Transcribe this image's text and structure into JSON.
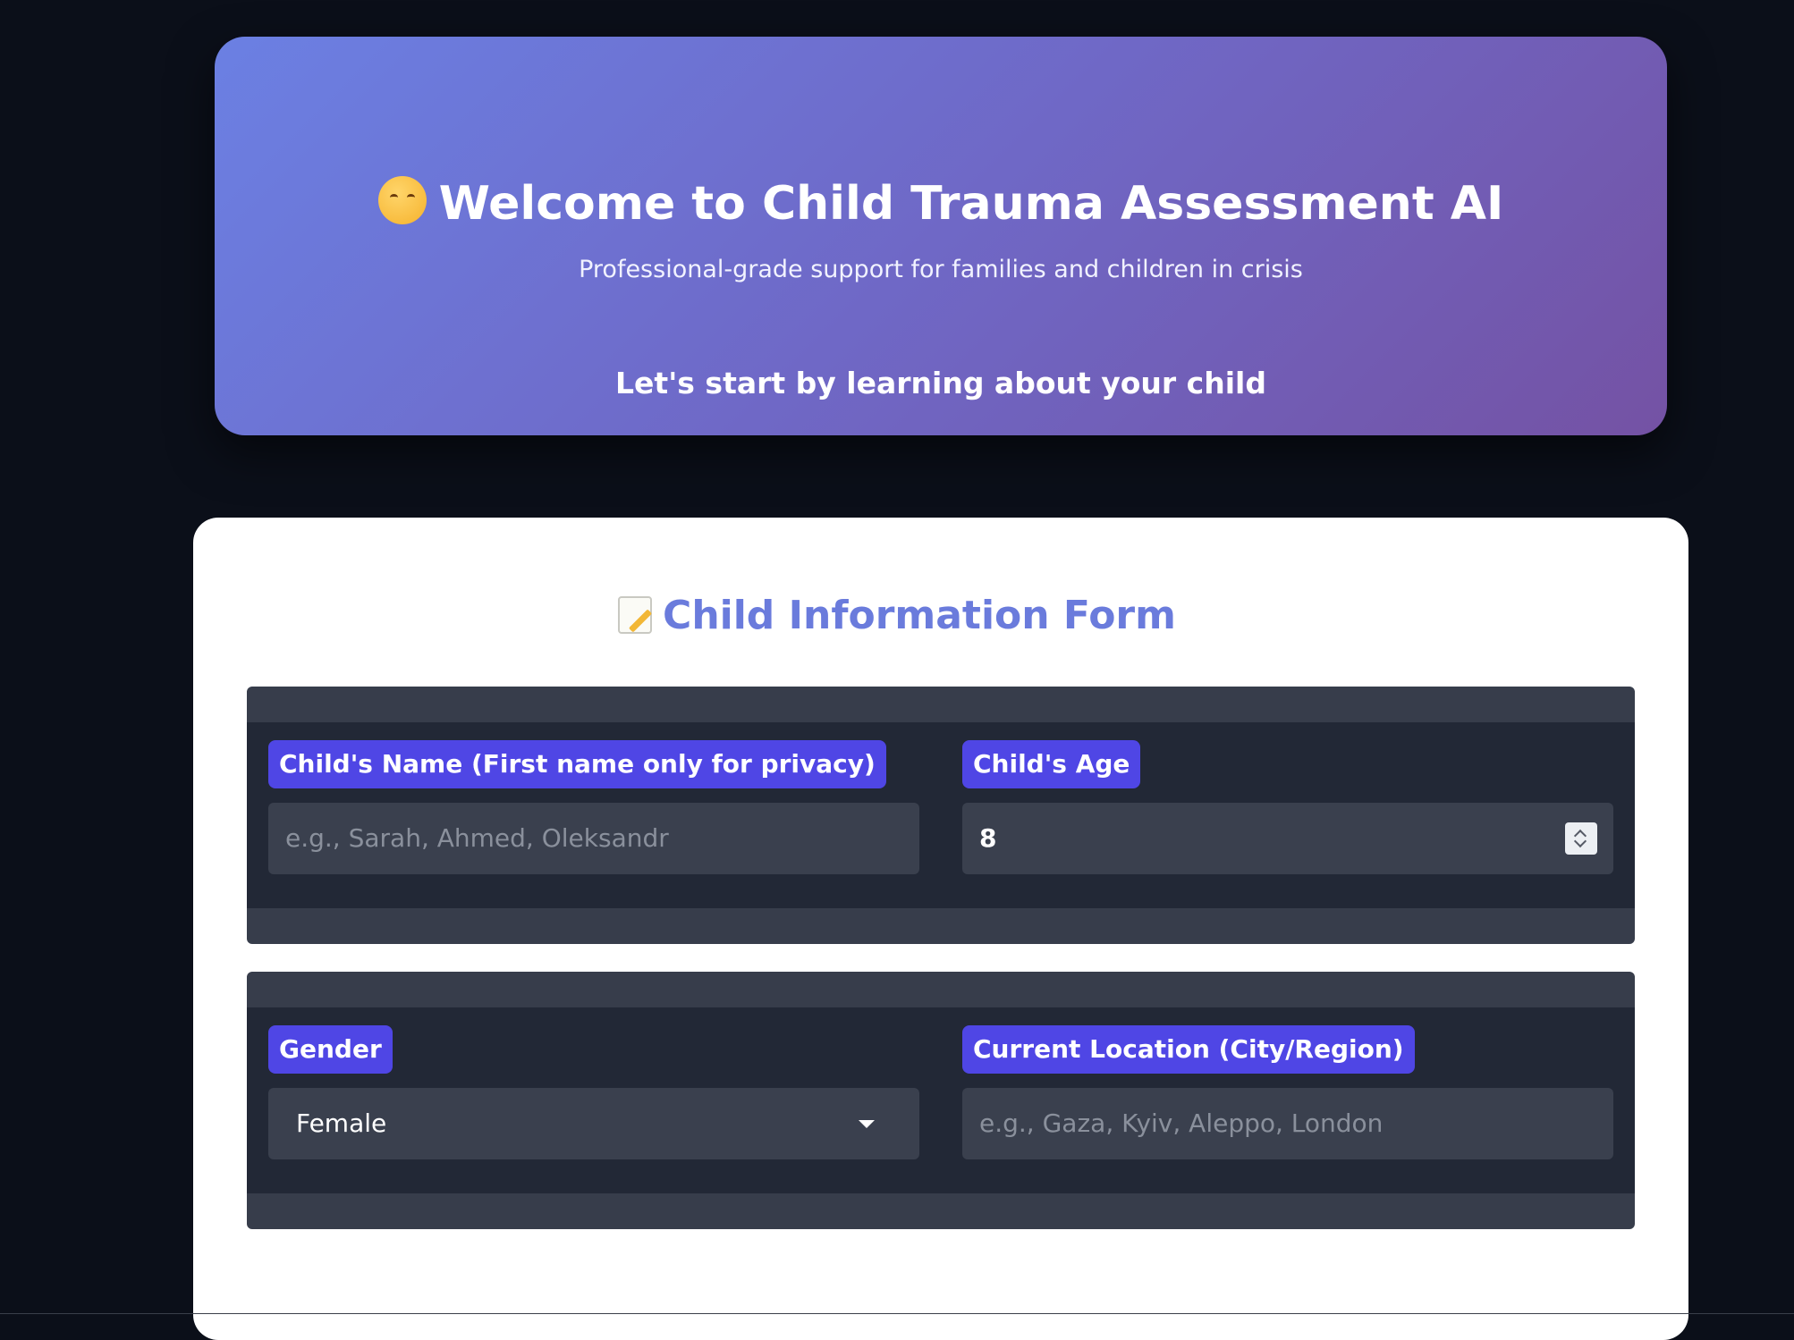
{
  "hero": {
    "title": "Welcome to Child Trauma Assessment AI",
    "subtitle": "Professional-grade support for families and children in crisis",
    "prompt": "Let's start by learning about your child"
  },
  "form": {
    "title": "Child Information Form",
    "name": {
      "label": "Child's Name (First name only for privacy)",
      "value": "",
      "placeholder": "e.g., Sarah, Ahmed, Oleksandr"
    },
    "age": {
      "label": "Child's Age",
      "value": "8"
    },
    "gender": {
      "label": "Gender",
      "selected": "Female"
    },
    "location": {
      "label": "Current Location (City/Region)",
      "value": "",
      "placeholder": "e.g., Gaza, Kyiv, Aleppo, London"
    }
  },
  "colors": {
    "page_background": "#0b0f19",
    "hero_gradient_start": "#6b80e3",
    "hero_gradient_end": "#7452a4",
    "form_title": "#6a7bdc",
    "label_background": "#4f46e5",
    "field_background": "#3a404e",
    "row_background": "#222836"
  },
  "icons": {
    "hero": "hugging-face-emoji",
    "form": "memo-emoji"
  }
}
